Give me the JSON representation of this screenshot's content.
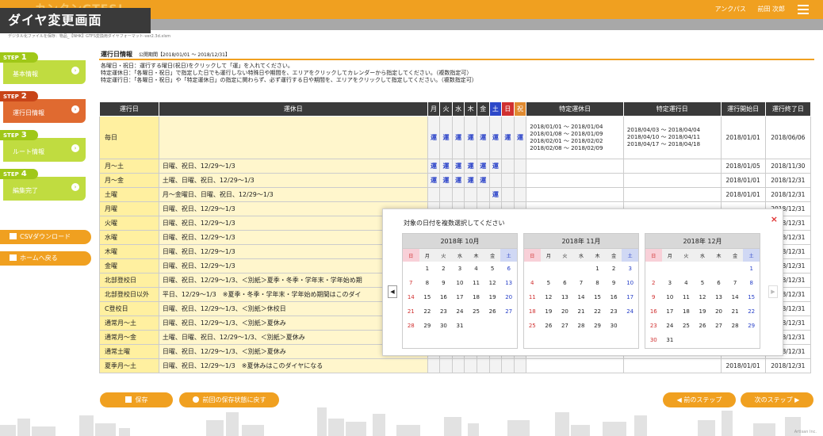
{
  "screen_label": "ダイヤ変更画面",
  "app": {
    "logo_text": "カンタンGTFS!",
    "company": "アンクパス",
    "user": "前田 次郎",
    "file_path": "デジタル化ファイルを保存：物品_【NHK】GTFS変換用ダイヤフォーマット-ver2.3d.xlsm"
  },
  "steps": [
    {
      "num": "1",
      "label": "基本情報",
      "active": false
    },
    {
      "num": "2",
      "label": "運行日情報",
      "active": true
    },
    {
      "num": "3",
      "label": "ルート情報",
      "active": false
    },
    {
      "num": "4",
      "label": "編集完了",
      "active": false
    }
  ],
  "step_prefix": "STEP",
  "side_buttons": {
    "csv": "CSVダウンロード",
    "home": "ホームへ戻る"
  },
  "header": {
    "title": "運行日情報",
    "period": "公開期間【2018/01/01 〜 2018/12/31】"
  },
  "instructions": [
    "各曜日・祝日：運行する曜日(祝日)をクリックして「運」を入れてください。",
    "特定運休日：「各曜日・祝日」で指定した日でも運行しない特殊日や期間を、エリアをクリックしてカレンダーから指定してください。（複数指定可）",
    "特定運行日：「各曜日・祝日」や「特定運休日」の指定に関わらず、必ず運行する日や期間を、エリアをクリックして指定してください。（複数指定可）"
  ],
  "table": {
    "headers": {
      "service_day": "運行日",
      "holiday": "運休日",
      "days": [
        "月",
        "火",
        "水",
        "木",
        "金",
        "土",
        "日",
        "祝"
      ],
      "special_off": "特定運休日",
      "special_on": "特定運行日",
      "start": "運行開始日",
      "end": "運行終了日"
    },
    "mark": "運",
    "rows": [
      {
        "name": "毎日",
        "holiday": "",
        "days": [
          1,
          1,
          1,
          1,
          1,
          1,
          1,
          1
        ],
        "special_off": [
          "2018/01/01 〜 2018/01/04",
          "2018/01/08 〜 2018/01/09",
          "2018/02/01 〜 2018/02/02",
          "2018/02/08 〜 2018/02/09"
        ],
        "special_on": [
          "2018/04/03 〜 2018/04/04",
          "2018/04/10 〜 2018/04/11",
          "2018/04/17 〜 2018/04/18"
        ],
        "start": "2018/01/01",
        "end": "2018/06/06"
      },
      {
        "name": "月〜土",
        "holiday": "日曜、祝日、12/29〜1/3",
        "days": [
          1,
          1,
          1,
          1,
          1,
          1,
          0,
          0
        ],
        "special_off": [],
        "special_on": [],
        "start": "2018/01/05",
        "end": "2018/11/30"
      },
      {
        "name": "月〜金",
        "holiday": "土曜、日曜、祝日、12/29〜1/3",
        "days": [
          1,
          1,
          1,
          1,
          1,
          0,
          0,
          0
        ],
        "special_off": [],
        "special_on": [],
        "start": "2018/01/01",
        "end": "2018/12/31"
      },
      {
        "name": "土曜",
        "holiday": "月〜金曜日、日曜、祝日、12/29〜1/3",
        "days": [
          0,
          0,
          0,
          0,
          0,
          1,
          0,
          0
        ],
        "special_off": [],
        "special_on": [],
        "start": "2018/01/01",
        "end": "2018/12/31"
      },
      {
        "name": "月曜",
        "holiday": "日曜、祝日、12/29〜1/3",
        "days": [
          0,
          0,
          0,
          0,
          0,
          0,
          0,
          0
        ],
        "special_off": [],
        "special_on": [],
        "start": "",
        "end": "2018/12/31"
      },
      {
        "name": "火曜",
        "holiday": "日曜、祝日、12/29〜1/3",
        "days": [
          0,
          0,
          0,
          0,
          0,
          0,
          0,
          0
        ],
        "special_off": [],
        "special_on": [],
        "start": "",
        "end": "2018/12/31"
      },
      {
        "name": "水曜",
        "holiday": "日曜、祝日、12/29〜1/3",
        "days": [
          0,
          0,
          0,
          0,
          0,
          0,
          0,
          0
        ],
        "special_off": [],
        "special_on": [],
        "start": "",
        "end": "2018/12/31"
      },
      {
        "name": "木曜",
        "holiday": "日曜、祝日、12/29〜1/3",
        "days": [
          0,
          0,
          0,
          0,
          0,
          0,
          0,
          0
        ],
        "special_off": [],
        "special_on": [],
        "start": "",
        "end": "2018/12/31"
      },
      {
        "name": "金曜",
        "holiday": "日曜、祝日、12/29〜1/3",
        "days": [
          0,
          0,
          0,
          0,
          0,
          0,
          0,
          0
        ],
        "special_off": [],
        "special_on": [],
        "start": "",
        "end": "2018/12/31"
      },
      {
        "name": "北部登校日",
        "holiday": "日曜、祝日、12/29〜1/3、＜別紙＞夏季・冬季・学年末・学年始め期",
        "days": [
          0,
          0,
          0,
          0,
          0,
          0,
          0,
          0
        ],
        "special_off": [],
        "special_on": [],
        "start": "",
        "end": "2018/12/31"
      },
      {
        "name": "北部登校日以外",
        "holiday": "平日、12/29〜1/3　※夏季・冬季・学年末・学年始め期間はこのダイ",
        "days": [
          0,
          0,
          0,
          0,
          0,
          0,
          0,
          0
        ],
        "special_off": [],
        "special_on": [],
        "start": "",
        "end": "2018/12/31"
      },
      {
        "name": "C登校日",
        "holiday": "日曜、祝日、12/29〜1/3、＜別紙＞休校日",
        "days": [
          0,
          0,
          0,
          0,
          0,
          0,
          0,
          0
        ],
        "special_off": [],
        "special_on": [],
        "start": "",
        "end": "2018/12/31"
      },
      {
        "name": "通常月〜土",
        "holiday": "日曜、祝日、12/29〜1/3、＜別紙＞夏休み",
        "days": [
          0,
          0,
          0,
          0,
          0,
          0,
          0,
          0
        ],
        "special_off": [],
        "special_on": [],
        "start": "",
        "end": "2018/12/31"
      },
      {
        "name": "通常月〜金",
        "holiday": "土曜、日曜、祝日、12/29〜1/3、＜別紙＞夏休み",
        "days": [
          0,
          0,
          0,
          0,
          0,
          0,
          0,
          0
        ],
        "special_off": [],
        "special_on": [],
        "start": "",
        "end": "2018/12/31"
      },
      {
        "name": "通常土曜",
        "holiday": "日曜、祝日、12/29〜1/3、＜別紙＞夏休み",
        "days": [
          0,
          0,
          0,
          0,
          0,
          0,
          0,
          0
        ],
        "special_off": [],
        "special_on": [],
        "start": "",
        "end": "2018/12/31"
      },
      {
        "name": "夏季月〜土",
        "holiday": "日曜、祝日、12/29〜1/3　※夏休みはこのダイヤになる",
        "days": [
          0,
          0,
          0,
          0,
          0,
          0,
          0,
          0
        ],
        "special_off": [],
        "special_on": [],
        "start": "2018/01/01",
        "end": "2018/12/31"
      }
    ]
  },
  "popup": {
    "title": "対象の日付を複数選択してください",
    "close": "×",
    "prev": "◀",
    "next": "▶",
    "weekday_labels": [
      "日",
      "月",
      "火",
      "水",
      "木",
      "金",
      "土"
    ],
    "months": [
      {
        "label": "2018年 10月",
        "weeks": [
          [
            "",
            "1",
            "2",
            "3",
            "4",
            "5",
            "6"
          ],
          [
            "7",
            "8",
            "9",
            "10",
            "11",
            "12",
            "13"
          ],
          [
            "14",
            "15",
            "16",
            "17",
            "18",
            "19",
            "20"
          ],
          [
            "21",
            "22",
            "23",
            "24",
            "25",
            "26",
            "27"
          ],
          [
            "28",
            "29",
            "30",
            "31",
            "",
            "",
            ""
          ]
        ]
      },
      {
        "label": "2018年 11月",
        "weeks": [
          [
            "",
            "",
            "",
            "",
            "1",
            "2",
            "3"
          ],
          [
            "4",
            "5",
            "6",
            "7",
            "8",
            "9",
            "10"
          ],
          [
            "11",
            "12",
            "13",
            "14",
            "15",
            "16",
            "17"
          ],
          [
            "18",
            "19",
            "20",
            "21",
            "22",
            "23",
            "24"
          ],
          [
            "25",
            "26",
            "27",
            "28",
            "29",
            "30",
            ""
          ]
        ]
      },
      {
        "label": "2018年 12月",
        "weeks": [
          [
            "",
            "",
            "",
            "",
            "",
            "",
            "1"
          ],
          [
            "2",
            "3",
            "4",
            "5",
            "6",
            "7",
            "8"
          ],
          [
            "9",
            "10",
            "11",
            "12",
            "13",
            "14",
            "15"
          ],
          [
            "16",
            "17",
            "18",
            "19",
            "20",
            "21",
            "22"
          ],
          [
            "23",
            "24",
            "25",
            "26",
            "27",
            "28",
            "29"
          ],
          [
            "30",
            "31",
            "",
            "",
            "",
            "",
            ""
          ]
        ]
      }
    ]
  },
  "footer": {
    "save": "保存",
    "restore": "前回の保存状態に戻す",
    "prev_step": "前のステップ",
    "next_step": "次のステップ",
    "credit": "Artisan Inc."
  }
}
